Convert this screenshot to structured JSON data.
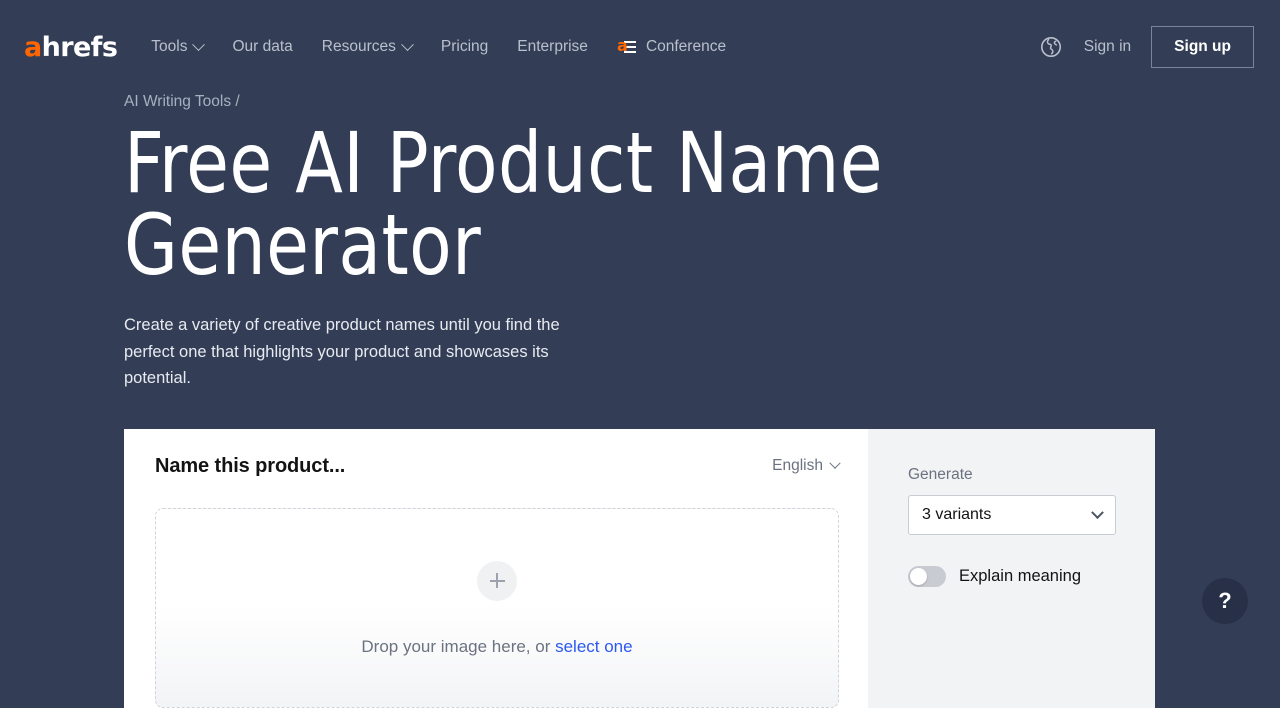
{
  "brand": {
    "logo_first": "a",
    "logo_rest": "hrefs"
  },
  "nav": {
    "items": [
      {
        "label": "Tools",
        "has_chevron": true
      },
      {
        "label": "Our data",
        "has_chevron": false
      },
      {
        "label": "Resources",
        "has_chevron": true
      },
      {
        "label": "Pricing",
        "has_chevron": false
      },
      {
        "label": "Enterprise",
        "has_chevron": false
      },
      {
        "label": "Conference",
        "has_chevron": false,
        "icon": "ahrefs-conference-mark",
        "mark_letter": "a"
      }
    ],
    "globe_icon": "globe-icon",
    "signin_label": "Sign in",
    "signup_label": "Sign up"
  },
  "hero": {
    "breadcrumb": "AI Writing Tools /",
    "title": "Free AI Product Name Generator",
    "description": "Create a variety of creative product names until you find the perfect one that highlights your product and showcases its potential."
  },
  "form": {
    "title": "Name this product...",
    "language": {
      "value": "English",
      "chevron_icon": "chevron-down-icon"
    },
    "dropzone": {
      "plus_icon": "plus-icon",
      "text_before": "Drop your image here, or ",
      "link_label": "select one"
    }
  },
  "panel": {
    "generate_label": "Generate",
    "variants": {
      "value": "3 variants",
      "chevron_icon": "chevron-down-icon"
    },
    "explain": {
      "label": "Explain meaning",
      "enabled": false
    }
  },
  "help": {
    "icon": "question-mark-icon",
    "label": "?"
  },
  "colors": {
    "background": "#333e56",
    "brand_orange": "#ff6600",
    "link_blue": "#2b59f0",
    "panel_gray": "#f2f3f5"
  }
}
